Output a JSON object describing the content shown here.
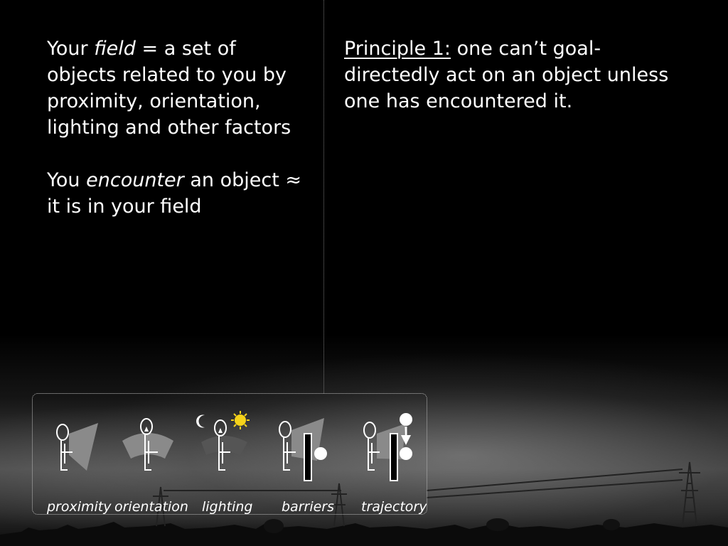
{
  "left": {
    "line1_pre": "Your ",
    "line1_em": "field",
    "line1_post": " = a set of",
    "line2": "objects related to you by",
    "line3": "proximity, orientation,",
    "line4": "lighting and other factors",
    "line5_pre": "You ",
    "line5_em": "encounter",
    "line5_post": " an object ≈",
    "line6": "it is in your field"
  },
  "right": {
    "principle_label": "Principle 1:",
    "line1": " one can’t goal-",
    "line2": "directedly act on an object unless",
    "line3": "one has encountered it."
  },
  "panel": {
    "captions": [
      "proximity",
      "orientation",
      "lighting",
      "barriers",
      "trajectory"
    ]
  }
}
